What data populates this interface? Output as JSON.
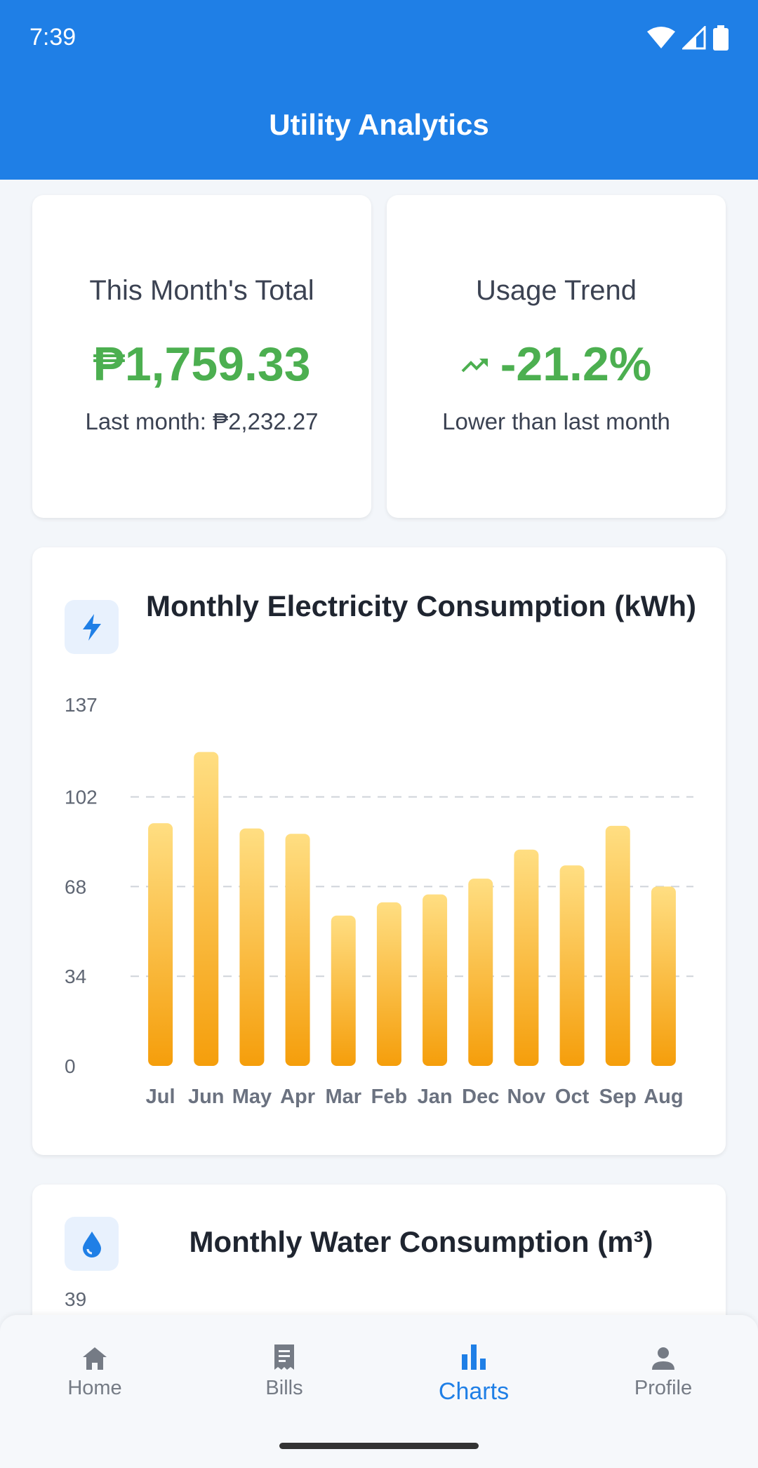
{
  "status_bar": {
    "time": "7:39",
    "icons": [
      "wifi-icon",
      "signal-icon",
      "battery-icon"
    ]
  },
  "app_bar": {
    "title": "Utility Analytics"
  },
  "summary": {
    "total": {
      "label": "This Month's Total",
      "value": "₱1,759.33",
      "sub": "Last month: ₱2,232.27"
    },
    "trend": {
      "label": "Usage Trend",
      "value": "-21.2%",
      "sub": "Lower than last month",
      "icon": "trending-icon"
    }
  },
  "electricity_chart": {
    "title": "Monthly Electricity Consumption (kWh)",
    "icon": "lightning-icon"
  },
  "water_chart": {
    "title": "Monthly Water Consumption (m³)",
    "icon": "water-drop-icon",
    "first_tick": "39"
  },
  "chart_data": {
    "type": "bar",
    "title": "Monthly Electricity Consumption (kWh)",
    "categories": [
      "Jul",
      "Jun",
      "May",
      "Apr",
      "Mar",
      "Feb",
      "Jan",
      "Dec",
      "Nov",
      "Oct",
      "Sep",
      "Aug"
    ],
    "values": [
      92,
      119,
      90,
      88,
      57,
      62,
      65,
      71,
      82,
      76,
      91,
      68
    ],
    "yticks": [
      "0",
      "34",
      "68",
      "102",
      "137"
    ],
    "ylim": [
      0,
      137
    ],
    "grid": true,
    "bar_gradient": [
      "#ffde82",
      "#f59e0b"
    ]
  },
  "bottom_nav": {
    "items": [
      {
        "label": "Home",
        "icon": "home-icon",
        "active": false
      },
      {
        "label": "Bills",
        "icon": "receipt-icon",
        "active": false
      },
      {
        "label": "Charts",
        "icon": "bar-chart-icon",
        "active": true
      },
      {
        "label": "Profile",
        "icon": "person-icon",
        "active": false
      }
    ]
  },
  "colors": {
    "primary": "#1f7fe6",
    "positive": "#4caf50"
  }
}
